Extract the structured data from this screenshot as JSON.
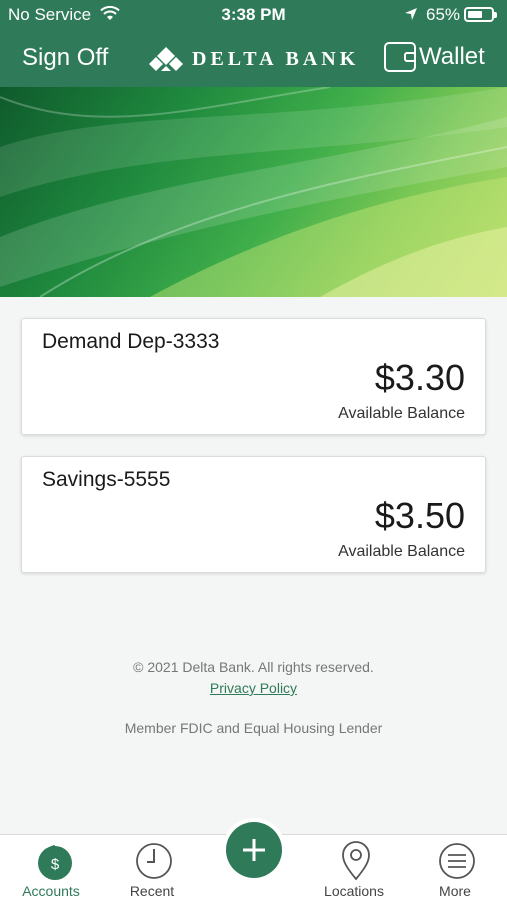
{
  "status_bar": {
    "carrier": "No Service",
    "time": "3:38 PM",
    "battery_pct": "65%",
    "battery_level": 0.65
  },
  "header": {
    "sign_off": "Sign Off",
    "brand": "DELTA BANK",
    "wallet": "Wallet"
  },
  "accounts": [
    {
      "name": "Demand Dep-3333",
      "amount": "$3.30",
      "balance_label": "Available Balance"
    },
    {
      "name": "Savings-5555",
      "amount": "$3.50",
      "balance_label": "Available Balance"
    }
  ],
  "footer": {
    "copyright": "© 2021 Delta Bank. All rights reserved.",
    "privacy": "Privacy Policy",
    "fdic": "Member FDIC and Equal Housing Lender"
  },
  "tabs": [
    {
      "label": "Accounts",
      "icon": "dollar-icon",
      "active": true
    },
    {
      "label": "Recent",
      "icon": "clock-icon"
    },
    {
      "label": "Locations",
      "icon": "map-pin-icon"
    },
    {
      "label": "More",
      "icon": "menu-icon"
    }
  ],
  "fab_icon": "plus-icon",
  "colors": {
    "brand_green": "#2f7a58",
    "background": "#f4f5f5"
  }
}
